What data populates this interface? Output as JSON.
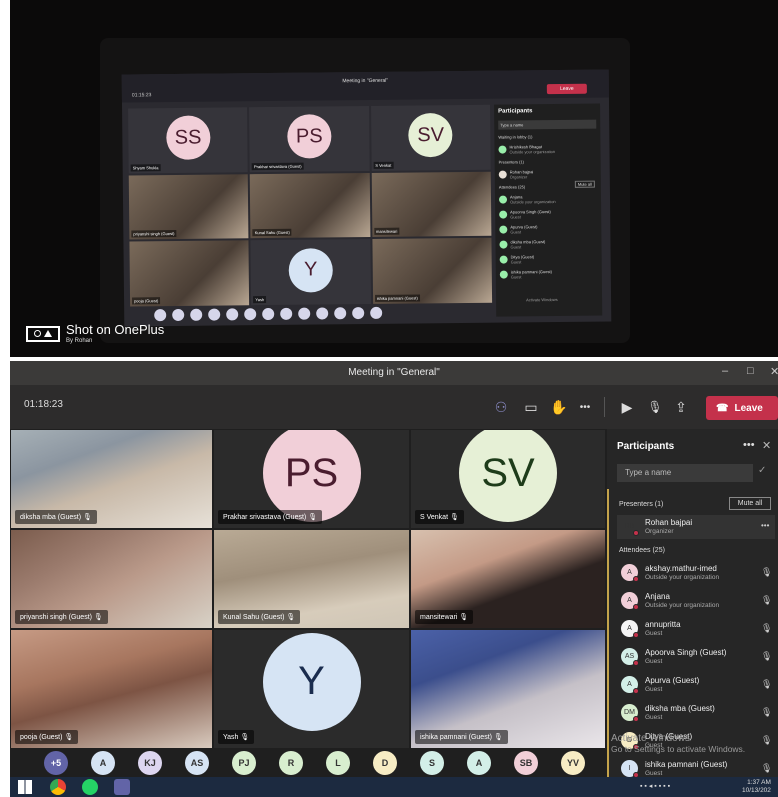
{
  "photo": {
    "laptop": {
      "window_title": "Meeting in \"General\"",
      "timer": "01:15:23",
      "leave_label": "Leave",
      "panel_header": "Participants",
      "panel_search": "Type a name",
      "waiting_in_lobby": "Waiting in lobby (1)",
      "lobby_person": "Hrishikesh Bhagat",
      "lobby_person_sub": "Outside your organization",
      "presenters": "Presenters (1)",
      "mute_all": "Mute all",
      "organizer_name": "Rohan bajpai",
      "organizer_role": "Organizer",
      "attendees": "Attendees (25)",
      "tiles": [
        {
          "initials": "SS",
          "name": "Shyam Shukla",
          "color": "#f1cfd8"
        },
        {
          "initials": "PS",
          "name": "Prakhar srivastava (Guest)",
          "color": "#f1cfd8"
        },
        {
          "initials": "SV",
          "name": "S Venkat",
          "color": "#e6f0d6"
        },
        {
          "initials": "",
          "name": "priyanshi singh (Guest)"
        },
        {
          "initials": "",
          "name": "Kunal Sahu (Guest)"
        },
        {
          "initials": "",
          "name": "mansitewari"
        },
        {
          "initials": "",
          "name": "pooja (Guest)"
        },
        {
          "initials": "Y",
          "name": "Yash",
          "color": "#d6e4f4"
        },
        {
          "initials": "",
          "name": "ishika pamnani (Guest)"
        }
      ],
      "panel_rows": [
        {
          "name": "Anjana",
          "sub": "Outside your organization"
        },
        {
          "name": "Apoorva Singh (Guest)",
          "sub": "Guest"
        },
        {
          "name": "Apurva (Guest)",
          "sub": "Guest"
        },
        {
          "name": "diksha mba (Guest)",
          "sub": "Guest"
        },
        {
          "name": "Ditya (Guest)",
          "sub": "Guest"
        },
        {
          "name": "ishika pamnani (Guest)",
          "sub": "Guest"
        }
      ],
      "activate_text": "Activate Windows"
    },
    "watermark": {
      "shot_on": "Shot on OnePlus",
      "by": "By Rohan"
    }
  },
  "app": {
    "window_title": "Meeting in \"General\"",
    "window_controls": {
      "minimize": "–",
      "maximize": "□",
      "close": "✕"
    },
    "timer": "01:18:23",
    "toolbar_icons": {
      "participants": "⚇",
      "chat": "▭",
      "raise_hand": "✋",
      "more": "•••",
      "camera_off": "▶",
      "mic_off": "🎙",
      "share": "⇪"
    },
    "leave": {
      "label": "Leave",
      "icon": "☎",
      "chevron": "⌄"
    },
    "tiles": [
      {
        "type": "video",
        "name": "diksha mba (Guest)",
        "variant": "v1"
      },
      {
        "type": "avatar",
        "initials": "PS",
        "name": "Prakhar srivastava (Guest)",
        "bg": "#f1cfd8",
        "fg": "#4a1d2f"
      },
      {
        "type": "avatar",
        "initials": "SV",
        "name": "S Venkat",
        "bg": "#e6f0d6",
        "fg": "#1e3c1a"
      },
      {
        "type": "video",
        "name": "priyanshi singh (Guest)",
        "variant": "v2"
      },
      {
        "type": "video",
        "name": "Kunal Sahu (Guest)",
        "variant": "v3"
      },
      {
        "type": "video",
        "name": "mansitewari",
        "variant": "v4"
      },
      {
        "type": "video",
        "name": "pooja (Guest)",
        "variant": "v5"
      },
      {
        "type": "avatar",
        "initials": "Y",
        "name": "Yash",
        "bg": "#d6e4f4",
        "fg": "#1a2c4e"
      },
      {
        "type": "video",
        "name": "ishika pamnani (Guest)",
        "variant": "v6"
      }
    ],
    "overflow_bubbles": [
      {
        "label": "+5",
        "bg": "#6264a7",
        "fg": "#ffffff"
      },
      {
        "label": "A",
        "bg": "#d6e4f4",
        "fg": "#333"
      },
      {
        "label": "KJ",
        "bg": "#ddd6f0",
        "fg": "#333"
      },
      {
        "label": "AS",
        "bg": "#d6e4f4",
        "fg": "#333"
      },
      {
        "label": "PJ",
        "bg": "#d8eecf",
        "fg": "#333"
      },
      {
        "label": "R",
        "bg": "#d8eecf",
        "fg": "#333"
      },
      {
        "label": "L",
        "bg": "#d8eecf",
        "fg": "#333"
      },
      {
        "label": "D",
        "bg": "#f7ecc4",
        "fg": "#333"
      },
      {
        "label": "S",
        "bg": "#d3efe8",
        "fg": "#333"
      },
      {
        "label": "A",
        "bg": "#d3efe8",
        "fg": "#333"
      },
      {
        "label": "SB",
        "bg": "#f1cfd8",
        "fg": "#333"
      },
      {
        "label": "YV",
        "bg": "#f7ecc4",
        "fg": "#333"
      }
    ],
    "panel": {
      "title": "Participants",
      "more_icon": "•••",
      "close_icon": "✕",
      "search_placeholder": "Type a name",
      "presenters_label": "Presenters (1)",
      "mute_all_label": "Mute all",
      "organizer": {
        "initials": "RB",
        "name": "Rohan bajpai",
        "role": "Organizer",
        "more": "•••",
        "color": "#e8e0d6"
      },
      "attendees_label": "Attendees (25)",
      "attendees": [
        {
          "initials": "A",
          "name": "akshay.mathur-imed",
          "sub": "Outside your organization",
          "color": "#f1cfd8"
        },
        {
          "initials": "A",
          "name": "Anjana",
          "sub": "Outside your organization",
          "color": "#f1cfd8"
        },
        {
          "initials": "A",
          "name": "annupritta",
          "sub": "Guest",
          "color": "#f4f4f4"
        },
        {
          "initials": "AS",
          "name": "Apoorva Singh (Guest)",
          "sub": "Guest",
          "color": "#d3efe8"
        },
        {
          "initials": "A",
          "name": "Apurva (Guest)",
          "sub": "Guest",
          "color": "#d3efe8"
        },
        {
          "initials": "DM",
          "name": "diksha mba (Guest)",
          "sub": "Guest",
          "color": "#d8eecf"
        },
        {
          "initials": "D",
          "name": "Ditya (Guest)",
          "sub": "Guest",
          "color": "#f7ecc4"
        },
        {
          "initials": "I",
          "name": "ishika pamnani (Guest)",
          "sub": "Guest",
          "color": "#d6e4f4"
        }
      ],
      "mic_icon": "🎙"
    },
    "activate": {
      "line1": "Activate Windows",
      "line2": "Go to Settings to activate Windows."
    },
    "taskbar": {
      "time": "1:37 AM",
      "date": "10/13/202"
    }
  }
}
